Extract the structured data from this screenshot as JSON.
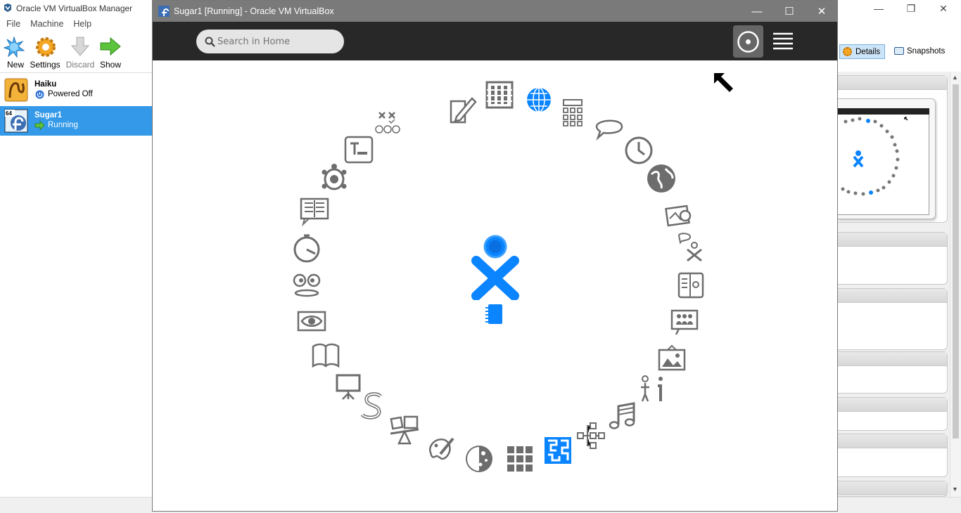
{
  "manager": {
    "title": "Oracle VM VirtualBox Manager",
    "menu": [
      "File",
      "Machine",
      "Help"
    ],
    "toolbar": {
      "new": "New",
      "settings": "Settings",
      "discard": "Discard",
      "show": "Show"
    },
    "vms": [
      {
        "name": "Haiku",
        "state": "Powered Off",
        "icon": "haiku-os-icon"
      },
      {
        "name": "Sugar1",
        "state": "Running",
        "icon": "fedora-64-icon",
        "badge": "64"
      }
    ],
    "tabs": {
      "details": "Details",
      "snapshots": "Snapshots"
    }
  },
  "vm_window": {
    "title": "Sugar1 [Running] - Oracle VM VirtualBox",
    "search_placeholder": "Search in Home"
  },
  "colors": {
    "accent": "#0a84ff",
    "icon_gray": "#6d6d6d",
    "sugar_bar": "#282828",
    "selection": "#3399e8"
  },
  "activities": [
    "implode-icon",
    "abacus-icon",
    "write-icon",
    "browse-icon",
    "calculate-icon",
    "chat-icon",
    "clock-icon",
    "world-map-icon",
    "photo-icon",
    "speak-icon",
    "journal-book-icon",
    "group-icon",
    "image-viewer-icon",
    "help-icon",
    "music-icon",
    "mind-map-icon",
    "maze-icon",
    "grid-icon",
    "moon-icon",
    "paint-icon",
    "physics-icon",
    "snake-icon",
    "presentation-icon",
    "read-icon",
    "eye-icon",
    "face-icon",
    "stopwatch-icon",
    "reader-icon",
    "turtle-icon",
    "terminal-icon",
    "tictactoe-icon",
    "exchange-icon"
  ]
}
